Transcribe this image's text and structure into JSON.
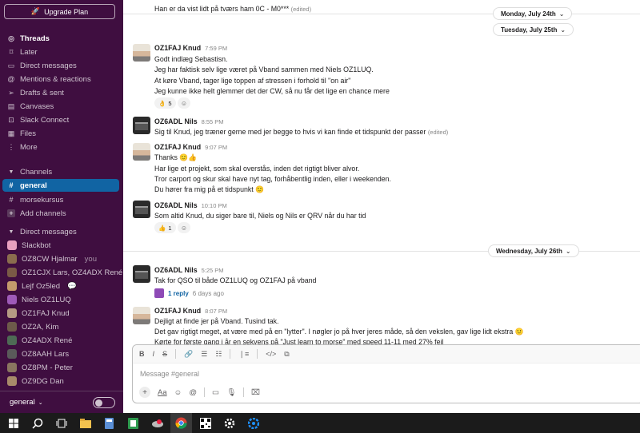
{
  "sidebar": {
    "upgrade_label": "Upgrade Plan",
    "nav": [
      {
        "label": "Threads",
        "icon": "threads-icon"
      },
      {
        "label": "Later",
        "icon": "bookmark-icon"
      },
      {
        "label": "Direct messages",
        "icon": "dm-icon"
      },
      {
        "label": "Mentions & reactions",
        "icon": "at-icon"
      },
      {
        "label": "Drafts & sent",
        "icon": "send-icon"
      },
      {
        "label": "Canvases",
        "icon": "canvas-icon"
      },
      {
        "label": "Slack Connect",
        "icon": "connect-icon"
      },
      {
        "label": "Files",
        "icon": "files-icon"
      },
      {
        "label": "More",
        "icon": "more-icon"
      }
    ],
    "channels_header": "Channels",
    "channels": [
      "general",
      "morsekursus"
    ],
    "add_channels": "Add channels",
    "dm_header": "Direct messages",
    "dms": [
      {
        "name": "Slackbot",
        "color": "#e8a0bf",
        "suffix": ""
      },
      {
        "name": "OZ8CW Hjalmar",
        "color": "#8b6d4e",
        "suffix": "you"
      },
      {
        "name": "OZ1CJX Lars, OZ4ADX René",
        "color": "#7a5a46",
        "suffix": ""
      },
      {
        "name": "Lejf Oz5led",
        "color": "#c49a6c",
        "suffix": "💬"
      },
      {
        "name": "Niels OZ1LUQ",
        "color": "#9e5ab8",
        "suffix": ""
      },
      {
        "name": "OZ1FAJ Knud",
        "color": "#b59a84",
        "suffix": ""
      },
      {
        "name": "OZ2A, Kim",
        "color": "#6d5a4a",
        "suffix": ""
      },
      {
        "name": "OZ4ADX René",
        "color": "#4e6a55",
        "suffix": ""
      },
      {
        "name": "OZ8AAH Lars",
        "color": "#5a5a5a",
        "suffix": ""
      },
      {
        "name": "OZ8PM - Peter",
        "color": "#8a7560",
        "suffix": ""
      },
      {
        "name": "OZ9DG Dan",
        "color": "#a88a6a",
        "suffix": ""
      }
    ],
    "workspace_label": "general"
  },
  "messages": {
    "top_line": "Han er da vist lidt på tværs ham 0C - M0***",
    "top_edited": "(edited)",
    "date1": "Monday, July 24th",
    "date2": "Tuesday, July 25th",
    "date3": "Wednesday, July 26th",
    "m1": {
      "author": "OZ1FAJ Knud",
      "time": "7:59 PM",
      "lines": [
        "Godt indlæg Sebastisn.",
        "Jeg har faktisk selv lige været på Vband sammen med Niels OZ1LUQ.",
        "At køre Vband, tager lige toppen af stressen i forhold til \"on air\"",
        "Jeg kunne ikke helt glemmer det der CW, så nu får det lige en chance mere"
      ],
      "reaction": "👌",
      "reaction_count": "5"
    },
    "m2": {
      "author": "OZ6ADL Nils",
      "time": "8:55 PM",
      "line": "Sig til Knud, jeg træner gerne med jer begge to hvis vi kan finde et tidspunkt der passer",
      "edited": "(edited)"
    },
    "m3": {
      "author": "OZ1FAJ Knud",
      "time": "9:07 PM",
      "lines": [
        "Thanks 🙂👍",
        "Har lige et projekt, som skal overstås, inden det rigtigt bliver alvor.",
        "Tror carport og skur skal have nyt tag, forhåbentlig inden, eller i weekenden.",
        "Du hører fra mig på et tidspunkt 🙂"
      ]
    },
    "m4": {
      "author": "OZ6ADL Nils",
      "time": "10:10 PM",
      "line": "Som altid Knud, du siger bare til, Niels og Nils er QRV når du har tid",
      "reaction": "👍",
      "reaction_count": "1"
    },
    "m5": {
      "author": "OZ6ADL Nils",
      "time": "5:25 PM",
      "line": "Tak for QSO til både OZ1LUQ og OZ1FAJ på vband",
      "replies": "1 reply",
      "replies_ago": "6 days ago"
    },
    "m6": {
      "author": "OZ1FAJ Knud",
      "time": "8:07 PM",
      "lines": [
        "Dejligt at finde jer på Vband. Tusind tak.",
        "Det gav rigtigt meget, at være med på en \"lytter\". I nøgler jo på hver jeres måde, så den vekslen, gav lige lidt ekstra 🙂",
        "Kørte for første gang i år en sekvens på \"Just learn to morse\" med speed 11-11 med 27% fejl"
      ]
    }
  },
  "composer": {
    "placeholder": "Message #general"
  }
}
